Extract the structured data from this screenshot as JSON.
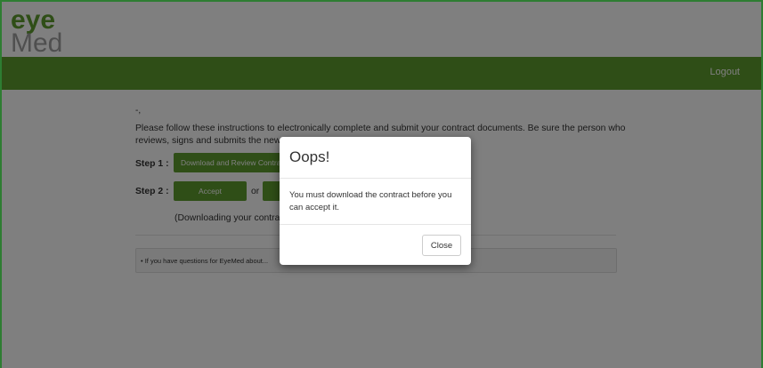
{
  "brand": {
    "logo_text_top": "eye",
    "logo_text_bottom": "Med",
    "accent": "#5e9c2e"
  },
  "navbar": {
    "logout_label": "Logout"
  },
  "main": {
    "dash": "-,",
    "instructions": "Please follow these instructions to electronically complete and submit your contract documents. Be sure the person who reviews, signs and submits the new contract...",
    "step1_label": "Step 1 :",
    "step1_button": "Download and Review Contract",
    "step2_label": "Step 2 :",
    "accept_button": "Accept",
    "or_text": "or",
    "download_note": "(Downloading your contract...",
    "info_text": "If you have questions for EyeMed about..."
  },
  "modal": {
    "title": "Oops!",
    "body": "You must download the contract before you can accept it.",
    "close_label": "Close"
  }
}
